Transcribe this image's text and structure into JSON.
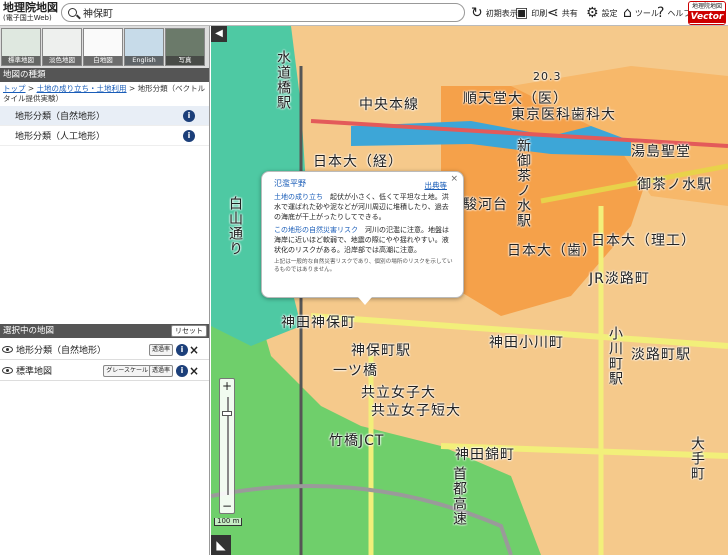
{
  "header": {
    "title": "地理院地図",
    "subtitle": "(電子国土Web)",
    "search_value": "神保町",
    "buttons": [
      {
        "label": "初期表示",
        "icon": "refresh-icon"
      },
      {
        "label": "印刷",
        "icon": "printer-icon"
      },
      {
        "label": "共有",
        "icon": "share-icon"
      },
      {
        "label": "設定",
        "icon": "gear-icon"
      },
      {
        "label": "ツール",
        "icon": "tool-icon"
      },
      {
        "label": "ヘルプ",
        "icon": "help-icon"
      }
    ],
    "logo_top": "地理院地図",
    "logo_bottom": "Vector"
  },
  "sidebar": {
    "thumbnails": [
      "標準地図",
      "淡色地図",
      "白地図",
      "English",
      "写真"
    ],
    "category_heading": "地図の種類",
    "breadcrumb": {
      "top": "トップ",
      "link": "土地の成り立ち・土地利用",
      "current": "地形分類（ベクトルタイル提供実験）"
    },
    "categories": [
      {
        "label": "地形分類（自然地形）",
        "selected": true
      },
      {
        "label": "地形分類（人工地形）",
        "selected": false
      }
    ],
    "selected_heading": "選択中の地図",
    "reset_label": "リセット",
    "selected_layers": [
      {
        "label": "地形分類（自然地形）",
        "buttons": [
          "透過率"
        ]
      },
      {
        "label": "標準地図",
        "buttons": [
          "グレースケール",
          "透過率"
        ]
      }
    ]
  },
  "map": {
    "labels": [
      {
        "text": "中央本線",
        "dir": "h"
      },
      {
        "text": "順天堂大（医）",
        "dir": "h"
      },
      {
        "text": "東京医科歯科大",
        "dir": "h"
      },
      {
        "text": "湯島聖堂",
        "dir": "h"
      },
      {
        "text": "日本大（経）",
        "dir": "h"
      },
      {
        "text": "駿河台",
        "dir": "h"
      },
      {
        "text": "日本大（理工）",
        "dir": "h"
      },
      {
        "text": "日本大（歯）",
        "dir": "h"
      },
      {
        "text": "JR淡路町",
        "dir": "h"
      },
      {
        "text": "神田神保町",
        "dir": "h"
      },
      {
        "text": "神田小川町",
        "dir": "h"
      },
      {
        "text": "神保町駅",
        "dir": "h"
      },
      {
        "text": "一ツ橋",
        "dir": "h"
      },
      {
        "text": "共立女子大",
        "dir": "h"
      },
      {
        "text": "共立女子短大",
        "dir": "h"
      },
      {
        "text": "竹橋JCT",
        "dir": "h"
      },
      {
        "text": "神田錦町",
        "dir": "h"
      },
      {
        "text": "淡路町駅",
        "dir": "h"
      },
      {
        "text": "水道橋駅",
        "dir": "v"
      },
      {
        "text": "御茶ノ水駅",
        "dir": "h"
      },
      {
        "text": "小川町駅",
        "dir": "v"
      },
      {
        "text": "新御茶ノ水駅",
        "dir": "v"
      },
      {
        "text": "大手町",
        "dir": "v"
      },
      {
        "text": "白山通り",
        "dir": "v"
      },
      {
        "text": "20.3",
        "dir": "h"
      },
      {
        "text": "首都高速",
        "dir": "v"
      }
    ],
    "scale_label": "100 m",
    "zoom_in": "+",
    "zoom_out": "−"
  },
  "popup": {
    "title": "氾濫平野",
    "source_link": "出典等",
    "origin_heading": "土地の成り立ち",
    "origin_text": "起伏が小さく、低くて平坦な土地。洪水で運ばれた砂や泥などが河川周辺に堆積したり、過去の海底が干上がったりしてできる。",
    "risk_heading": "この地形の自然災害リスク",
    "risk_text": "河川の氾濫に注意。地盤は海岸に近いほど軟弱で、地震の際にやや揺れやすい。液状化のリスクがある。沿岸部では高潮に注意。",
    "note": "上記は一般的な自然災害リスクであり、個別の場所のリスクを示しているものではありません。",
    "close": "×"
  },
  "colors": {
    "lowland": "#f7c07a",
    "terrace": "#f5a14a",
    "artificial": "#6fcf6b",
    "river": "#3da6d7",
    "cut": "#d4c4c0"
  }
}
